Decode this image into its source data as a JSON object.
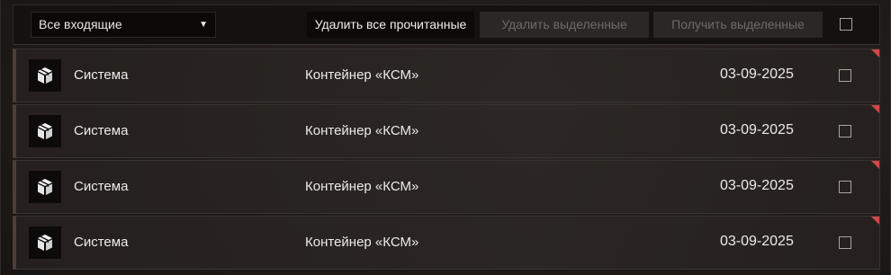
{
  "toolbar": {
    "filter_selected": "Все входящие",
    "delete_read_label": "Удалить все прочитанные",
    "delete_selected_label": "Удалить выделенные",
    "receive_selected_label": "Получить выделенные"
  },
  "messages": [
    {
      "sender": "Система",
      "subject": "Контейнер «КСМ»",
      "date": "03-09-2025",
      "icon": "package-icon",
      "unread": true
    },
    {
      "sender": "Система",
      "subject": "Контейнер «КСМ»",
      "date": "03-09-2025",
      "icon": "package-icon",
      "unread": true
    },
    {
      "sender": "Система",
      "subject": "Контейнер «КСМ»",
      "date": "03-09-2025",
      "icon": "package-icon",
      "unread": true
    },
    {
      "sender": "Система",
      "subject": "Контейнер «КСМ»",
      "date": "03-09-2025",
      "icon": "package-icon",
      "unread": true
    }
  ],
  "colors": {
    "unread_marker": "#d04848",
    "disabled_text": "#6e6a66"
  }
}
